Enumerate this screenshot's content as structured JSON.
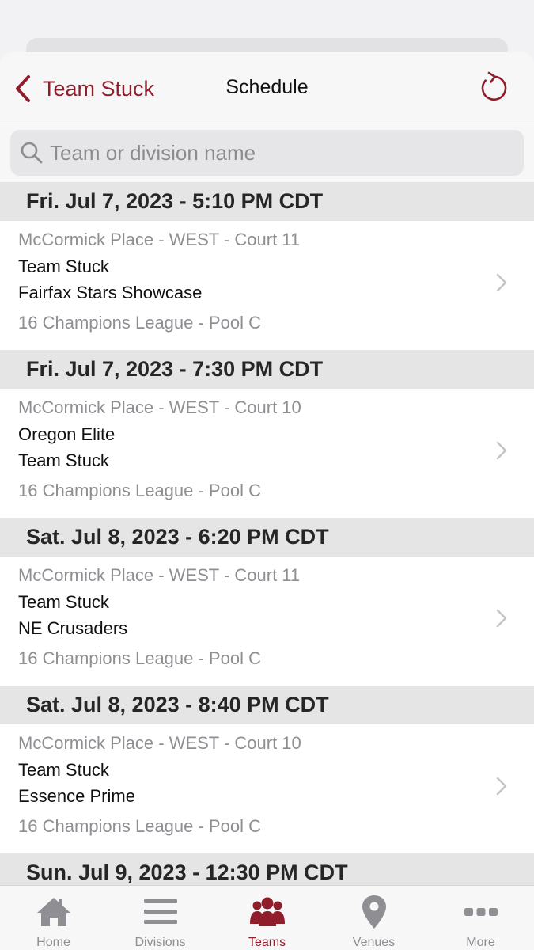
{
  "nav": {
    "back_label": "Team Stuck",
    "title": "Schedule"
  },
  "search": {
    "placeholder": "Team or division name",
    "value": ""
  },
  "schedule": [
    {
      "header": "Fri. Jul 7, 2023 - 5:10 PM CDT",
      "venue": "McCormick Place - WEST  - Court 11",
      "team1": "Team Stuck",
      "team2": "Fairfax Stars Showcase",
      "division": "16 Champions League - Pool C"
    },
    {
      "header": "Fri. Jul 7, 2023 - 7:30 PM CDT",
      "venue": "McCormick Place - WEST  - Court 10",
      "team1": "Oregon Elite",
      "team2": "Team Stuck",
      "division": "16 Champions League - Pool C"
    },
    {
      "header": "Sat. Jul 8, 2023 - 6:20 PM CDT",
      "venue": "McCormick Place - WEST  - Court 11",
      "team1": "Team Stuck",
      "team2": "NE Crusaders",
      "division": "16 Champions League - Pool C"
    },
    {
      "header": "Sat. Jul 8, 2023 - 8:40 PM CDT",
      "venue": "McCormick Place - WEST  - Court 10",
      "team1": "Team Stuck",
      "team2": "Essence Prime",
      "division": "16 Champions League - Pool C"
    },
    {
      "header": "Sun. Jul 9, 2023 - 12:30 PM CDT"
    }
  ],
  "tabs": [
    {
      "label": "Home",
      "icon": "house-icon",
      "active": false
    },
    {
      "label": "Divisions",
      "icon": "list-icon",
      "active": false
    },
    {
      "label": "Teams",
      "icon": "people-icon",
      "active": true
    },
    {
      "label": "Venues",
      "icon": "location-pin-icon",
      "active": false
    },
    {
      "label": "More",
      "icon": "ellipsis-icon",
      "active": false
    }
  ],
  "colors": {
    "accent": "#8f1d2c",
    "inactive": "#8e8e93",
    "section_bg": "#e5e5e5"
  }
}
